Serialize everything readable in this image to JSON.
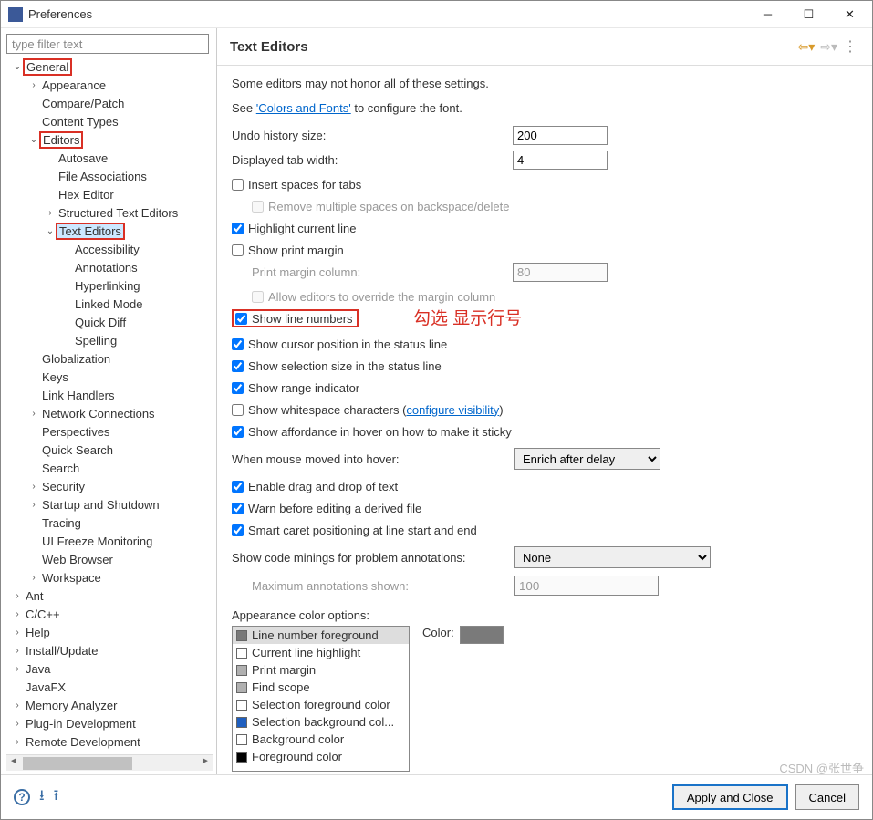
{
  "window": {
    "title": "Preferences"
  },
  "filter_placeholder": "type filter text",
  "tree": [
    {
      "l": "General",
      "d": 0,
      "e": "open",
      "hl": true
    },
    {
      "l": "Appearance",
      "d": 1,
      "e": "closed"
    },
    {
      "l": "Compare/Patch",
      "d": 1
    },
    {
      "l": "Content Types",
      "d": 1
    },
    {
      "l": "Editors",
      "d": 1,
      "e": "open",
      "hl": true
    },
    {
      "l": "Autosave",
      "d": 2
    },
    {
      "l": "File Associations",
      "d": 2
    },
    {
      "l": "Hex Editor",
      "d": 2
    },
    {
      "l": "Structured Text Editors",
      "d": 2,
      "e": "closed"
    },
    {
      "l": "Text Editors",
      "d": 2,
      "e": "open",
      "hl": true,
      "sel": true
    },
    {
      "l": "Accessibility",
      "d": 3
    },
    {
      "l": "Annotations",
      "d": 3
    },
    {
      "l": "Hyperlinking",
      "d": 3
    },
    {
      "l": "Linked Mode",
      "d": 3
    },
    {
      "l": "Quick Diff",
      "d": 3
    },
    {
      "l": "Spelling",
      "d": 3
    },
    {
      "l": "Globalization",
      "d": 1
    },
    {
      "l": "Keys",
      "d": 1
    },
    {
      "l": "Link Handlers",
      "d": 1
    },
    {
      "l": "Network Connections",
      "d": 1,
      "e": "closed"
    },
    {
      "l": "Perspectives",
      "d": 1
    },
    {
      "l": "Quick Search",
      "d": 1
    },
    {
      "l": "Search",
      "d": 1
    },
    {
      "l": "Security",
      "d": 1,
      "e": "closed"
    },
    {
      "l": "Startup and Shutdown",
      "d": 1,
      "e": "closed"
    },
    {
      "l": "Tracing",
      "d": 1
    },
    {
      "l": "UI Freeze Monitoring",
      "d": 1
    },
    {
      "l": "Web Browser",
      "d": 1
    },
    {
      "l": "Workspace",
      "d": 1,
      "e": "closed"
    },
    {
      "l": "Ant",
      "d": 0,
      "e": "closed"
    },
    {
      "l": "C/C++",
      "d": 0,
      "e": "closed"
    },
    {
      "l": "Help",
      "d": 0,
      "e": "closed"
    },
    {
      "l": "Install/Update",
      "d": 0,
      "e": "closed"
    },
    {
      "l": "Java",
      "d": 0,
      "e": "closed"
    },
    {
      "l": "JavaFX",
      "d": 0
    },
    {
      "l": "Memory Analyzer",
      "d": 0,
      "e": "closed"
    },
    {
      "l": "Plug-in Development",
      "d": 0,
      "e": "closed"
    },
    {
      "l": "Remote Development",
      "d": 0,
      "e": "closed"
    }
  ],
  "page": {
    "title": "Text Editors",
    "intro": "Some editors may not honor all of these settings.",
    "see_pre": "See ",
    "see_link": "'Colors and Fonts'",
    "see_post": " to configure the font.",
    "undo_label": "Undo history size:",
    "undo_value": "200",
    "tab_label": "Displayed tab width:",
    "tab_value": "4",
    "chk_insert_spaces": "Insert spaces for tabs",
    "chk_remove_multi": "Remove multiple spaces on backspace/delete",
    "chk_highlight": "Highlight current line",
    "chk_print_margin": "Show print margin",
    "print_col_label": "Print margin column:",
    "print_col_value": "80",
    "chk_override_margin": "Allow editors to override the margin column",
    "chk_line_numbers": "Show line numbers",
    "chk_cursor_pos": "Show cursor position in the status line",
    "chk_sel_size": "Show selection size in the status line",
    "chk_range": "Show range indicator",
    "chk_whitespace_pre": "Show whitespace characters (",
    "chk_whitespace_link": "configure visibility",
    "chk_whitespace_post": ")",
    "chk_affordance": "Show affordance in hover on how to make it sticky",
    "hover_label": "When mouse moved into hover:",
    "hover_value": "Enrich after delay",
    "chk_dnd": "Enable drag and drop of text",
    "chk_warn_derived": "Warn before editing a derived file",
    "chk_smart_caret": "Smart caret positioning at line start and end",
    "minings_label": "Show code minings for problem annotations:",
    "minings_value": "None",
    "max_anno_label": "Maximum annotations shown:",
    "max_anno_value": "100",
    "color_opts_label": "Appearance color options:",
    "color_label": "Color:",
    "color_items": [
      {
        "l": "Line number foreground",
        "c": "#787878",
        "sel": true
      },
      {
        "l": "Current line highlight",
        "c": "#ffffff"
      },
      {
        "l": "Print margin",
        "c": "#b0b0b0"
      },
      {
        "l": "Find scope",
        "c": "#b0b0b0"
      },
      {
        "l": "Selection foreground color",
        "c": "#ffffff"
      },
      {
        "l": "Selection background col...",
        "c": "#1f5fbf"
      },
      {
        "l": "Background color",
        "c": "#ffffff"
      },
      {
        "l": "Foreground color",
        "c": "#000000"
      }
    ]
  },
  "buttons": {
    "apply": "Apply and Close",
    "cancel": "Cancel"
  },
  "annotation": "勾选 显示行号",
  "watermark": "CSDN @张世争"
}
